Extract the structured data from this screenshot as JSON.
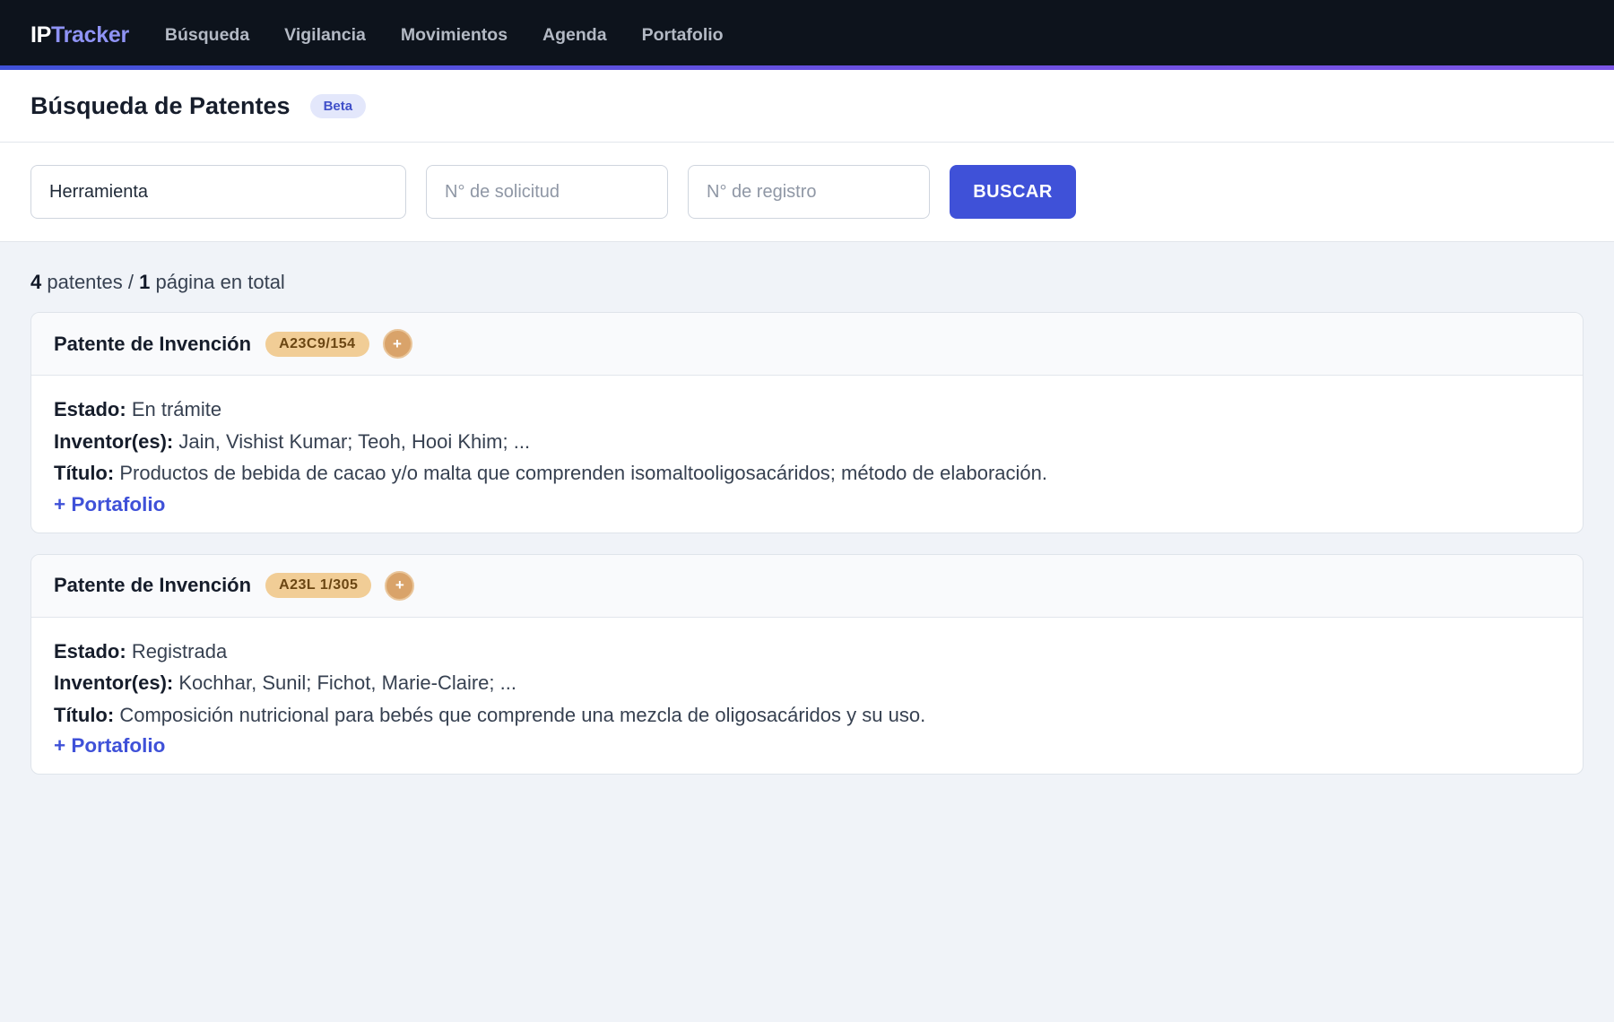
{
  "nav": {
    "brand_ip": "IP",
    "brand_tracker": "Tracker",
    "links": [
      "Búsqueda",
      "Vigilancia",
      "Movimientos",
      "Agenda",
      "Portafolio"
    ]
  },
  "header": {
    "title": "Búsqueda de Patentes",
    "badge": "Beta"
  },
  "search": {
    "query_value": "Herramienta",
    "application_placeholder": "N° de solicitud",
    "registration_placeholder": "N° de registro",
    "button_label": "BUSCAR"
  },
  "summary": {
    "count": "4",
    "count_label": " patentes / ",
    "pages": "1",
    "pages_label": " página en total"
  },
  "labels": {
    "status": "Estado:",
    "inventors": "Inventor(es):",
    "title": "Título:",
    "add_portfolio": "+ Portafolio",
    "plus": "+"
  },
  "results": [
    {
      "type": "Patente de Invención",
      "ipc": "A23C9/154",
      "status": "En trámite",
      "inventors": "Jain, Vishist Kumar; Teoh, Hooi Khim; ...",
      "title": "Productos de bebida de cacao y/o malta que comprenden isomaltooligosacáridos; método de elaboración."
    },
    {
      "type": "Patente de Invención",
      "ipc": "A23L 1/305",
      "status": "Registrada",
      "inventors": "Kochhar, Sunil; Fichot, Marie-Claire; ...",
      "title": "Composición nutricional para bebés que comprende una mezcla de oligosacáridos y su uso."
    }
  ]
}
